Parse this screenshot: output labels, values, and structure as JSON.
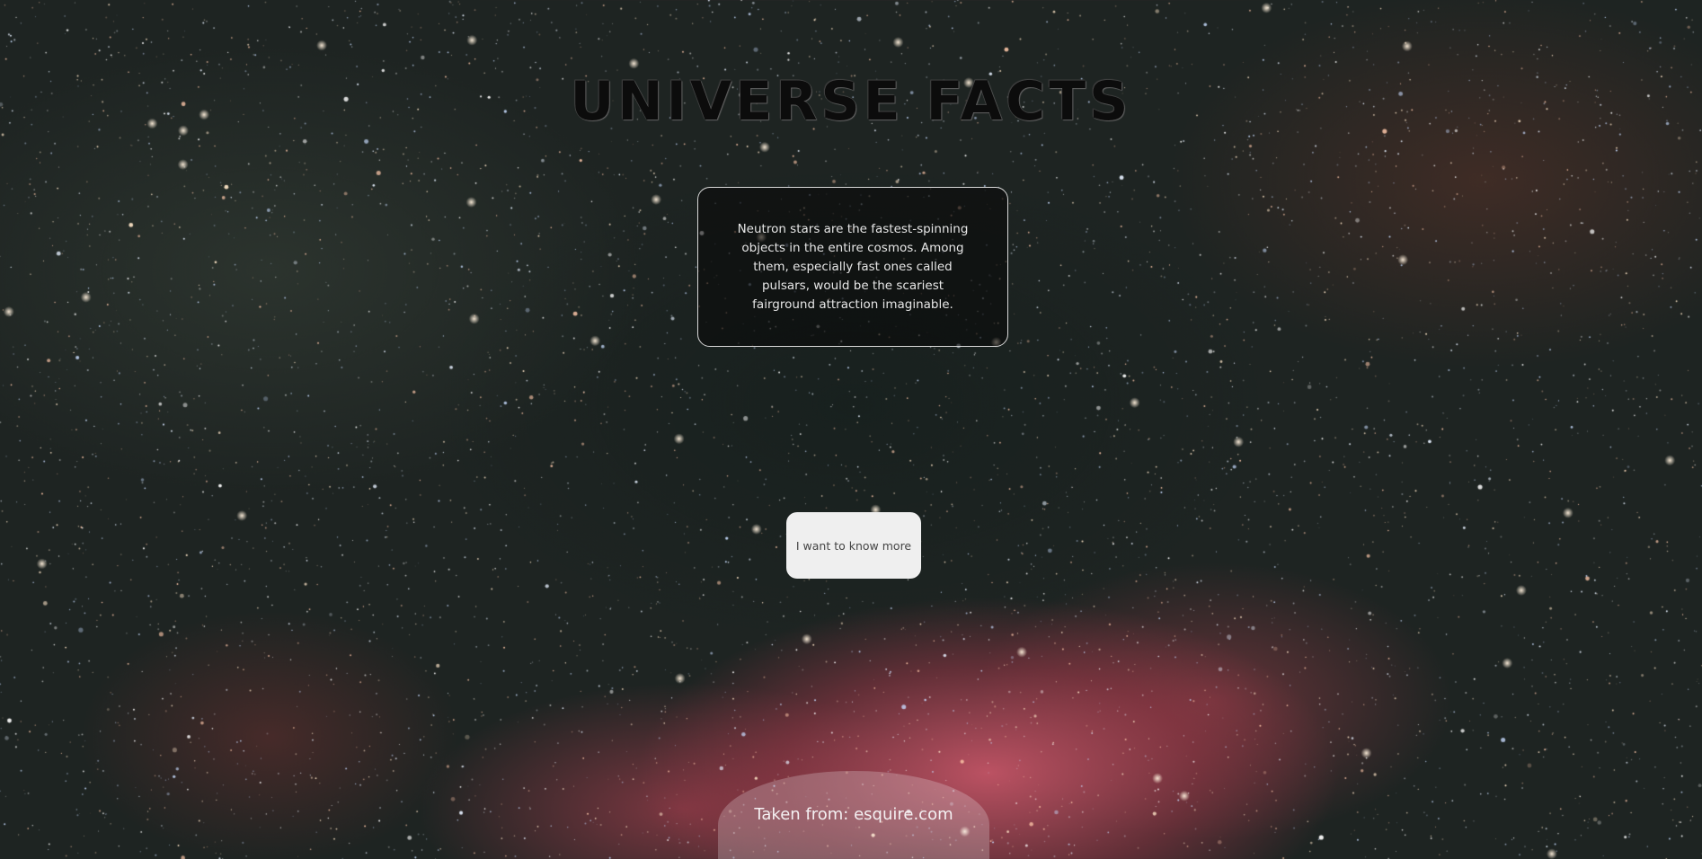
{
  "page": {
    "title": "UNIVERSE FACTS"
  },
  "fact": {
    "text": "Neutron stars are the fastest-spinning objects in the entire cosmos. Among them, especially fast ones called pulsars, would be the scariest fairground attraction imaginable."
  },
  "actions": {
    "more_label": "I want to know more"
  },
  "footer": {
    "source_label": "Taken from: esquire.com"
  },
  "colors": {
    "title": "#0c0c0c",
    "card_border": "#d8d8d8",
    "button_bg": "#efefef",
    "nebula": "#d75a6e"
  }
}
